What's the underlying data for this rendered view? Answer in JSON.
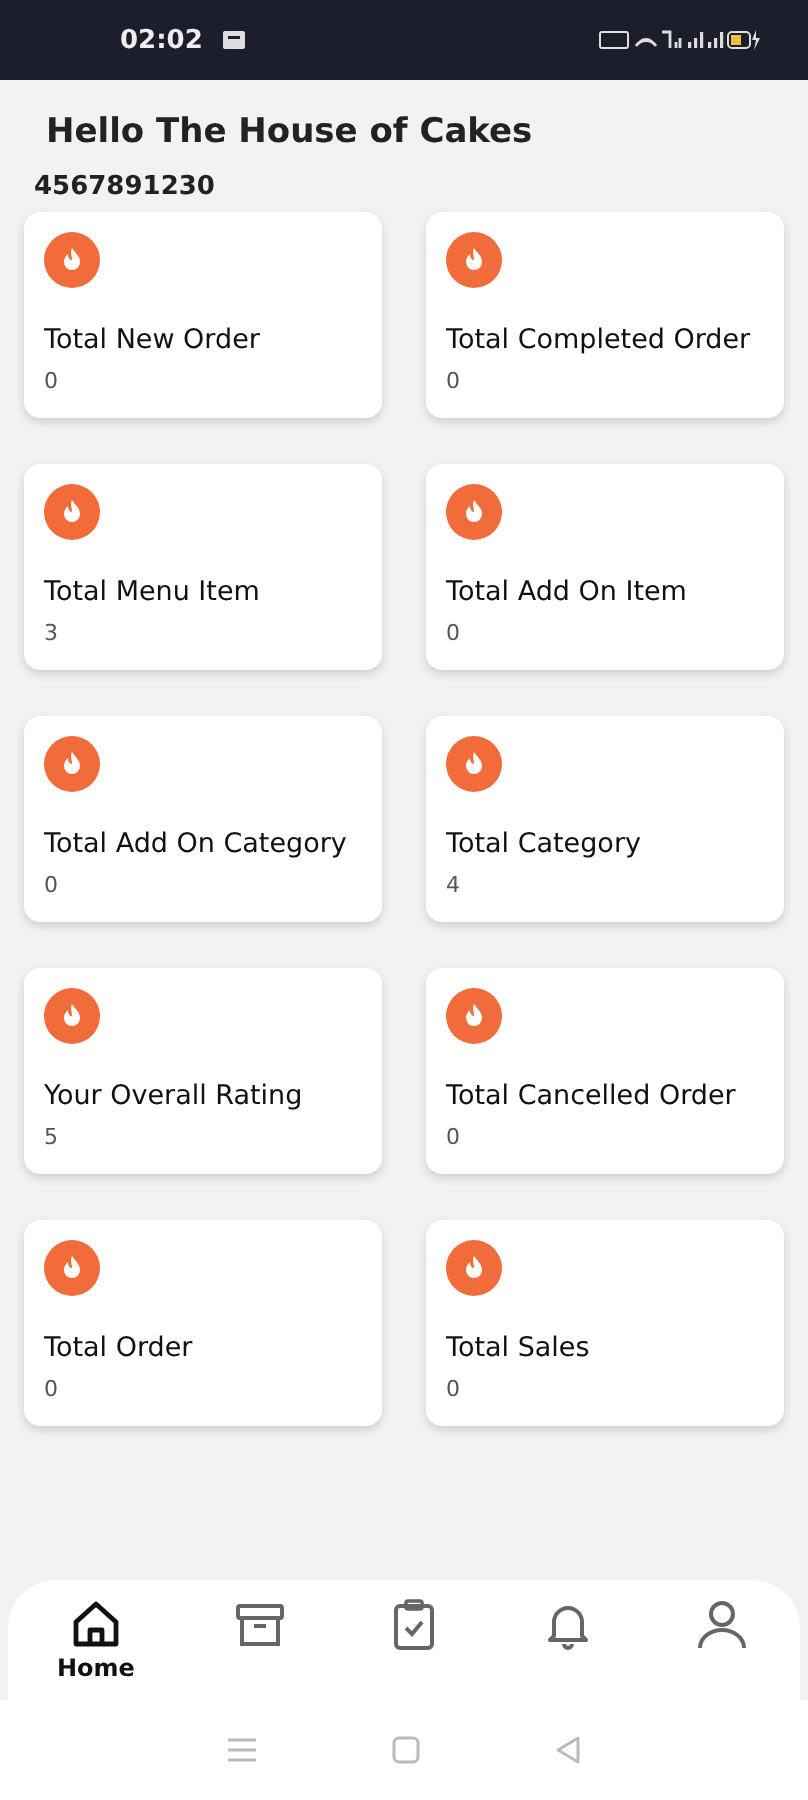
{
  "status_bar": {
    "time": "02:02"
  },
  "greeting": "Hello The House of Cakes",
  "phone": "4567891230",
  "columns": [
    [
      {
        "title": "Total New Order",
        "value": "0"
      },
      {
        "title": "Total Menu Item",
        "value": "3"
      },
      {
        "title": "Total Add On Category",
        "value": "0"
      },
      {
        "title": "Your Overall Rating",
        "value": "5"
      },
      {
        "title": "Total Order",
        "value": "0"
      }
    ],
    [
      {
        "title": "Total Completed Order",
        "value": "0"
      },
      {
        "title": "Total Add On Item",
        "value": "0"
      },
      {
        "title": "Total Category",
        "value": "4"
      },
      {
        "title": "Total Cancelled Order",
        "value": "0"
      },
      {
        "title": "Total Sales",
        "value": "0"
      }
    ]
  ],
  "bottom_nav": [
    {
      "kind": "home",
      "label": "Home",
      "selected": true
    },
    {
      "kind": "archive",
      "selected": false
    },
    {
      "kind": "clipboard",
      "selected": false
    },
    {
      "kind": "bell",
      "selected": false
    },
    {
      "kind": "profile",
      "selected": false
    }
  ]
}
